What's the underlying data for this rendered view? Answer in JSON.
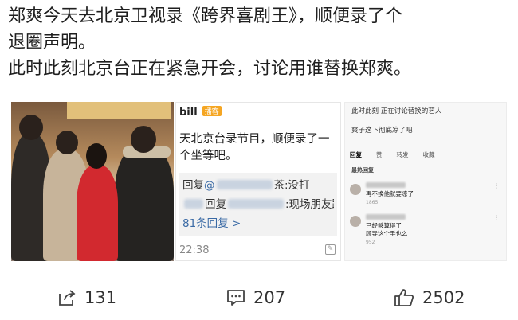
{
  "post": {
    "line1": "郑爽今天去北京卫视录《跨界喜剧王》，顺便录了个",
    "line2": "退圈声明。",
    "line3": "此时此刻北京台正在紧急开会，讨论用谁替换郑爽。"
  },
  "shot2": {
    "user": "bill",
    "badge": "播客",
    "body": "天北京台录节目，顺便录了一个坐等吧。",
    "reply1_prefix": "回复",
    "reply1_at": "@",
    "reply1_tail": "茶:没打",
    "reply2_prefix": "回复",
    "reply2_tail": ":现场朋友跟我",
    "more": "81条回复 >",
    "time": "22:38"
  },
  "shot3": {
    "title": "此时此刻 正在讨论替换的艺人",
    "question": "爽子这下彻底凉了吧",
    "tabs": [
      "回复",
      "赞",
      "转发",
      "收藏"
    ],
    "hot_label": "最热回复",
    "comments": [
      {
        "text": "再不换他就要凉了",
        "meta": "1865"
      },
      {
        "text": "已经够算得了",
        "text2": "顾导这个手也么",
        "meta": "952"
      }
    ]
  },
  "actions": {
    "share_count": "131",
    "comment_count": "207",
    "like_count": "2502"
  },
  "colors": {
    "text": "#1f1f1f",
    "link": "#3a6aa5",
    "badge": "#f5a623"
  }
}
